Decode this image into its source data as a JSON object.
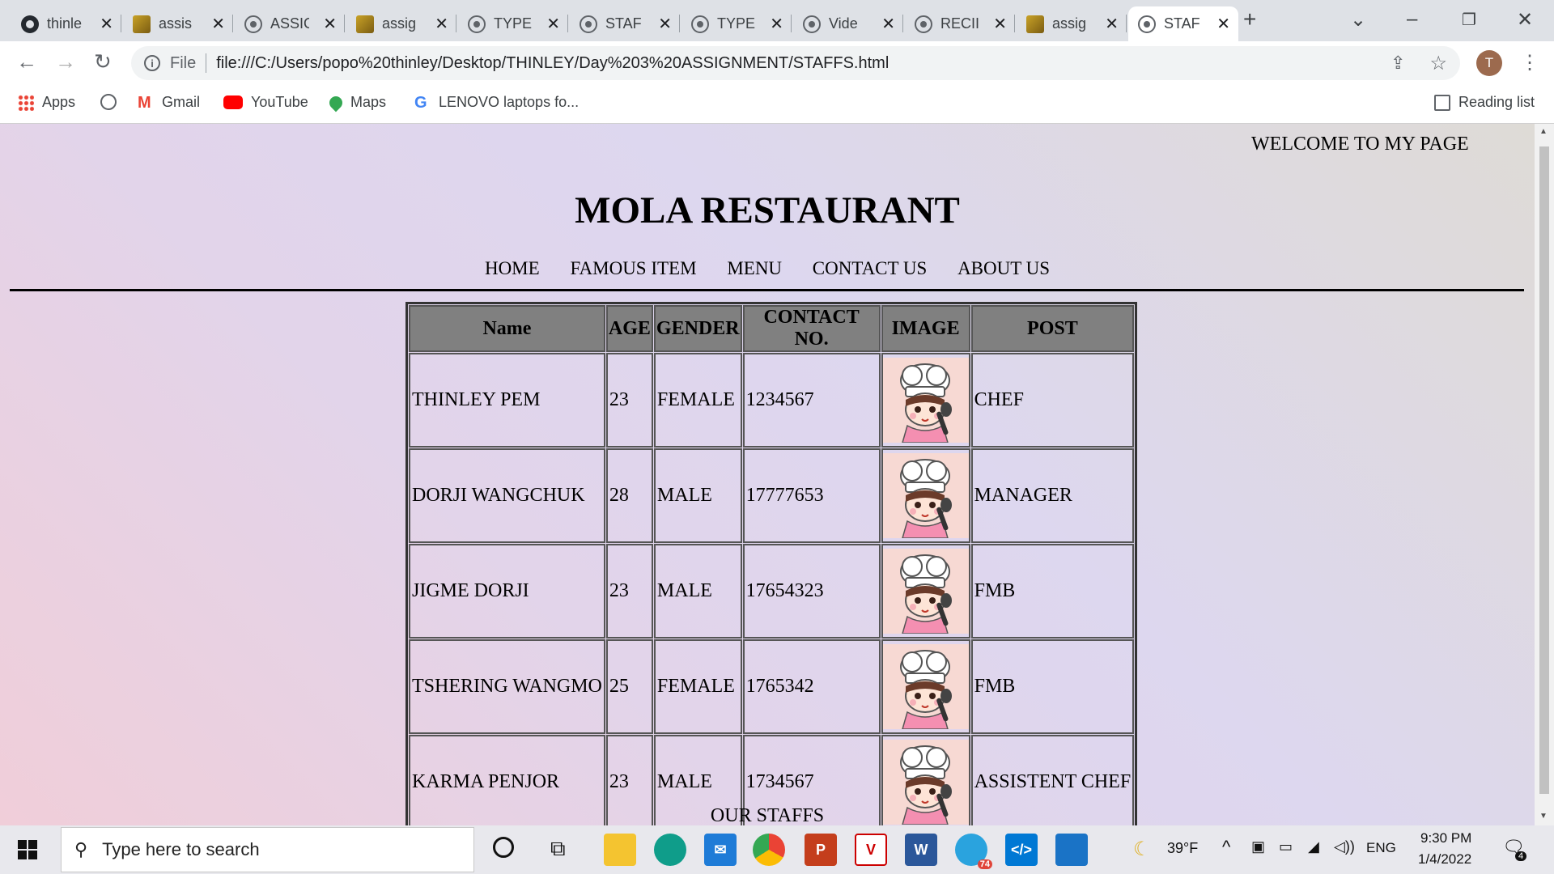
{
  "browser": {
    "tabs": [
      {
        "title": "thinle",
        "favicon": "github-icon"
      },
      {
        "title": "assis",
        "favicon": "image-icon"
      },
      {
        "title": "ASSIG",
        "favicon": "globe-icon"
      },
      {
        "title": "assig",
        "favicon": "image-icon"
      },
      {
        "title": "TYPE",
        "favicon": "globe-icon"
      },
      {
        "title": "STAF",
        "favicon": "globe-icon"
      },
      {
        "title": "TYPE",
        "favicon": "globe-icon"
      },
      {
        "title": "Vide",
        "favicon": "globe-icon"
      },
      {
        "title": "RECII",
        "favicon": "globe-icon"
      },
      {
        "title": "assig",
        "favicon": "image-icon"
      },
      {
        "title": "STAF",
        "favicon": "globe-icon",
        "active": true
      }
    ],
    "address": {
      "scheme_label": "File",
      "url": "file:///C:/Users/popo%20thinley/Desktop/THINLEY/Day%203%20ASSIGNMENT/STAFFS.html"
    },
    "profile_initial": "T",
    "bookmarks": [
      {
        "label": "Apps"
      },
      {
        "label": ""
      },
      {
        "label": "Gmail"
      },
      {
        "label": "YouTube"
      },
      {
        "label": "Maps"
      },
      {
        "label": "LENOVO laptops fo..."
      }
    ],
    "reading_list_label": "Reading list"
  },
  "page": {
    "welcome": "WELCOME TO MY PAGE",
    "title": "MOLA RESTAURANT",
    "nav": [
      "HOME",
      "FAMOUS ITEM",
      "MENU",
      "CONTACT US",
      "ABOUT US"
    ],
    "table": {
      "headers": [
        "Name",
        "AGE",
        "GENDER",
        "CONTACT NO.",
        "IMAGE",
        "POST"
      ],
      "rows": [
        {
          "name": "THINLEY PEM",
          "age": "23",
          "gender": "FEMALE",
          "contact": "1234567",
          "post": "CHEF"
        },
        {
          "name": "DORJI WANGCHUK",
          "age": "28",
          "gender": "MALE",
          "contact": "17777653",
          "post": "MANAGER"
        },
        {
          "name": "JIGME DORJI",
          "age": "23",
          "gender": "MALE",
          "contact": "17654323",
          "post": "FMB"
        },
        {
          "name": "TSHERING WANGMO",
          "age": "25",
          "gender": "FEMALE",
          "contact": "1765342",
          "post": "FMB"
        },
        {
          "name": "KARMA PENJOR",
          "age": "23",
          "gender": "MALE",
          "contact": "1734567",
          "post": "ASSISTENT CHEF"
        }
      ]
    },
    "caption": "OUR STAFFS"
  },
  "taskbar": {
    "search_placeholder": "Type here to search",
    "weather": "39°F",
    "language": "ENG",
    "time": "9:30 PM",
    "date": "1/4/2022",
    "notification_count": "4",
    "telegram_badge": "74"
  },
  "colors": {
    "tab_strip": "#dee1e6",
    "table_header": "#808080",
    "page_gradient": [
      "#f0ced9",
      "#ddd7ef",
      "#dedbd6"
    ]
  }
}
